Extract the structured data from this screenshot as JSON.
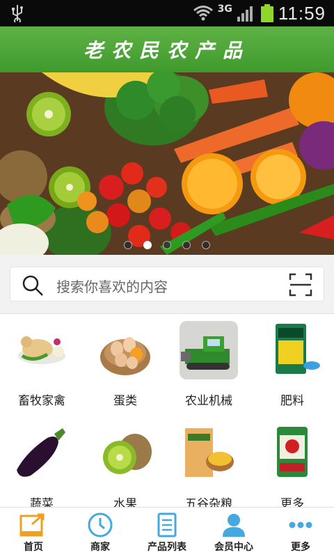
{
  "statusbar": {
    "network": "3G",
    "time": "11:59"
  },
  "header": {
    "title": "老农民农产品"
  },
  "banner": {
    "slide_count": 5,
    "active_index": 1
  },
  "search": {
    "placeholder": "搜索你喜欢的内容"
  },
  "categories": [
    {
      "label": "畜牧家禽",
      "icon": "poultry-icon"
    },
    {
      "label": "蛋类",
      "icon": "eggs-icon"
    },
    {
      "label": "农业机械",
      "icon": "harvester-icon"
    },
    {
      "label": "肥料",
      "icon": "fertilizer-icon"
    },
    {
      "label": "蔬菜",
      "icon": "eggplant-icon"
    },
    {
      "label": "水果",
      "icon": "kiwi-icon"
    },
    {
      "label": "五谷杂粮",
      "icon": "grain-icon"
    },
    {
      "label": "更多",
      "icon": "rice-bag-icon"
    }
  ],
  "tabs": [
    {
      "label": "首页",
      "icon": "home-icon"
    },
    {
      "label": "商家",
      "icon": "clock-icon"
    },
    {
      "label": "产品列表",
      "icon": "list-icon"
    },
    {
      "label": "会员中心",
      "icon": "user-icon"
    },
    {
      "label": "更多",
      "icon": "more-icon"
    }
  ],
  "colors": {
    "brand_green": "#4ca636",
    "tab_blue": "#45a8e0",
    "tab_orange": "#f0a020"
  }
}
